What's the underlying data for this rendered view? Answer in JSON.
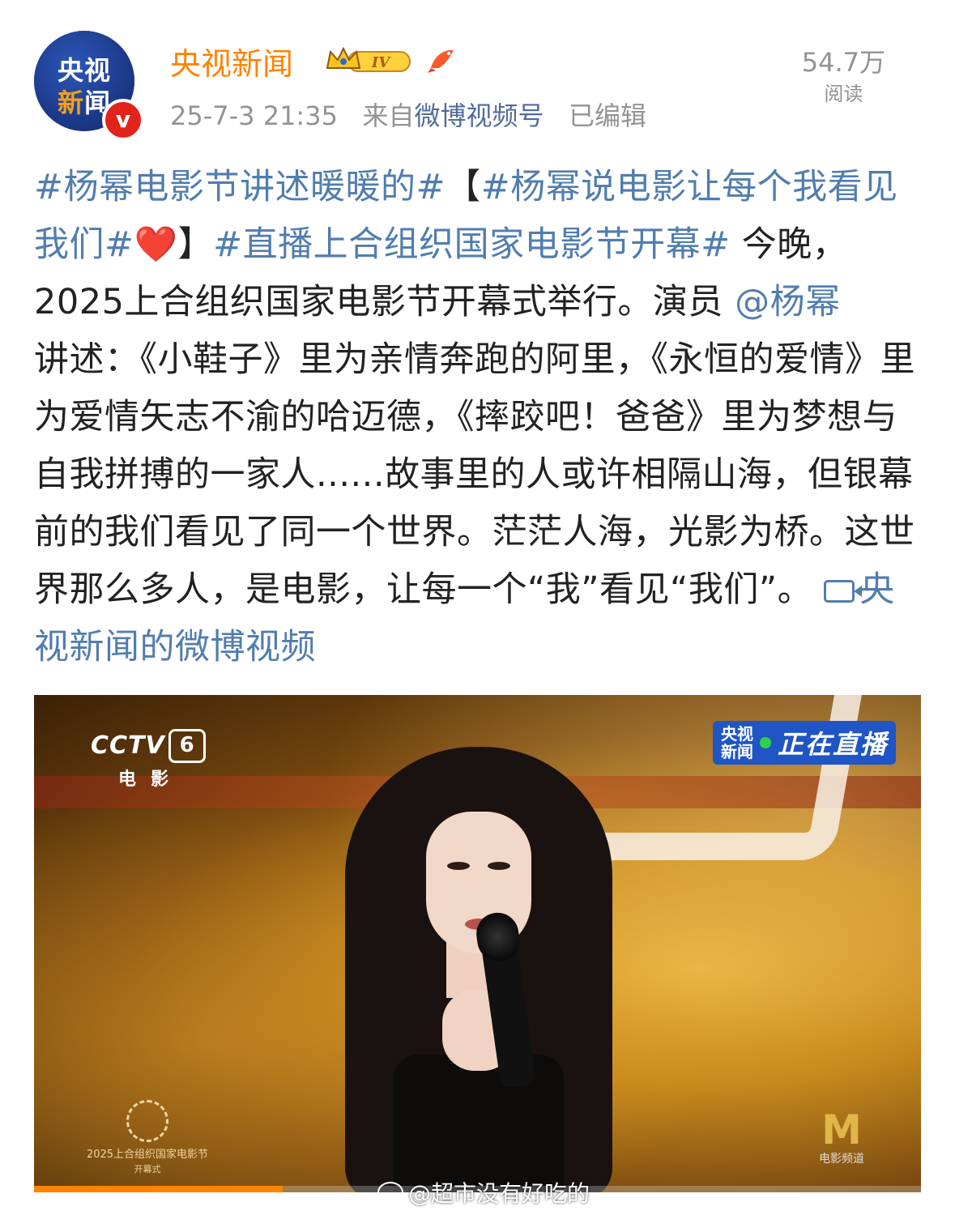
{
  "account": {
    "avatar_line1": "央视",
    "avatar_line2_a": "新",
    "avatar_line2_b": "闻",
    "verified_badge": "v",
    "name": "央视新闻",
    "level_badge": "IV",
    "level_icon": "crown-icon",
    "extra_icon": "koi-fish-icon"
  },
  "meta": {
    "timestamp": "25-7-3 21:35",
    "source_prefix": "来自",
    "source": "微博视频号",
    "edited": "已编辑"
  },
  "reads": {
    "count": "54.7万",
    "label": "阅读"
  },
  "post": {
    "tag1": "#杨幂电影节讲述暖暖的#",
    "bracket_open": "【",
    "tag2": "#杨幂说电影让每个我看见我们#",
    "heart": "❤️",
    "bracket_close": "】",
    "tag3": "#直播上合组织国家电影节开幕#",
    "text1": " 今晚，2025上合组织国家电影节开幕式举行。演员 ",
    "mention": "@杨幂",
    "text2": "讲述：《小鞋子》里为亲情奔跑的阿里，《永恒的爱情》里为爱情矢志不渝的哈迈德，《摔跤吧！爸爸》里为梦想与自我拼搏的一家人......故事里的人或许相隔山海，但银幕前的我们看见了同一个世界。茫茫人海，光影为桥。这世界那么多人，是电影，让每一个“我”看见“我们”。",
    "video_link": "央视新闻的微博视频"
  },
  "video": {
    "channel_logo": "CCTV",
    "channel_number": "6",
    "channel_name": "电影",
    "live_logo_line1": "央视",
    "live_logo_line2": "新闻",
    "live_text": "正在直播",
    "festival_line1": "2025上合组织国家电影节",
    "festival_line2": "开幕式",
    "movie_channel_logo": "M",
    "movie_channel_name": "电影频道",
    "progress": 0.28
  },
  "watermark": "@超市没有好吃的",
  "colors": {
    "username": "#ff8200",
    "link": "#507daf",
    "meta": "#939393",
    "verified": "#e2231a"
  }
}
